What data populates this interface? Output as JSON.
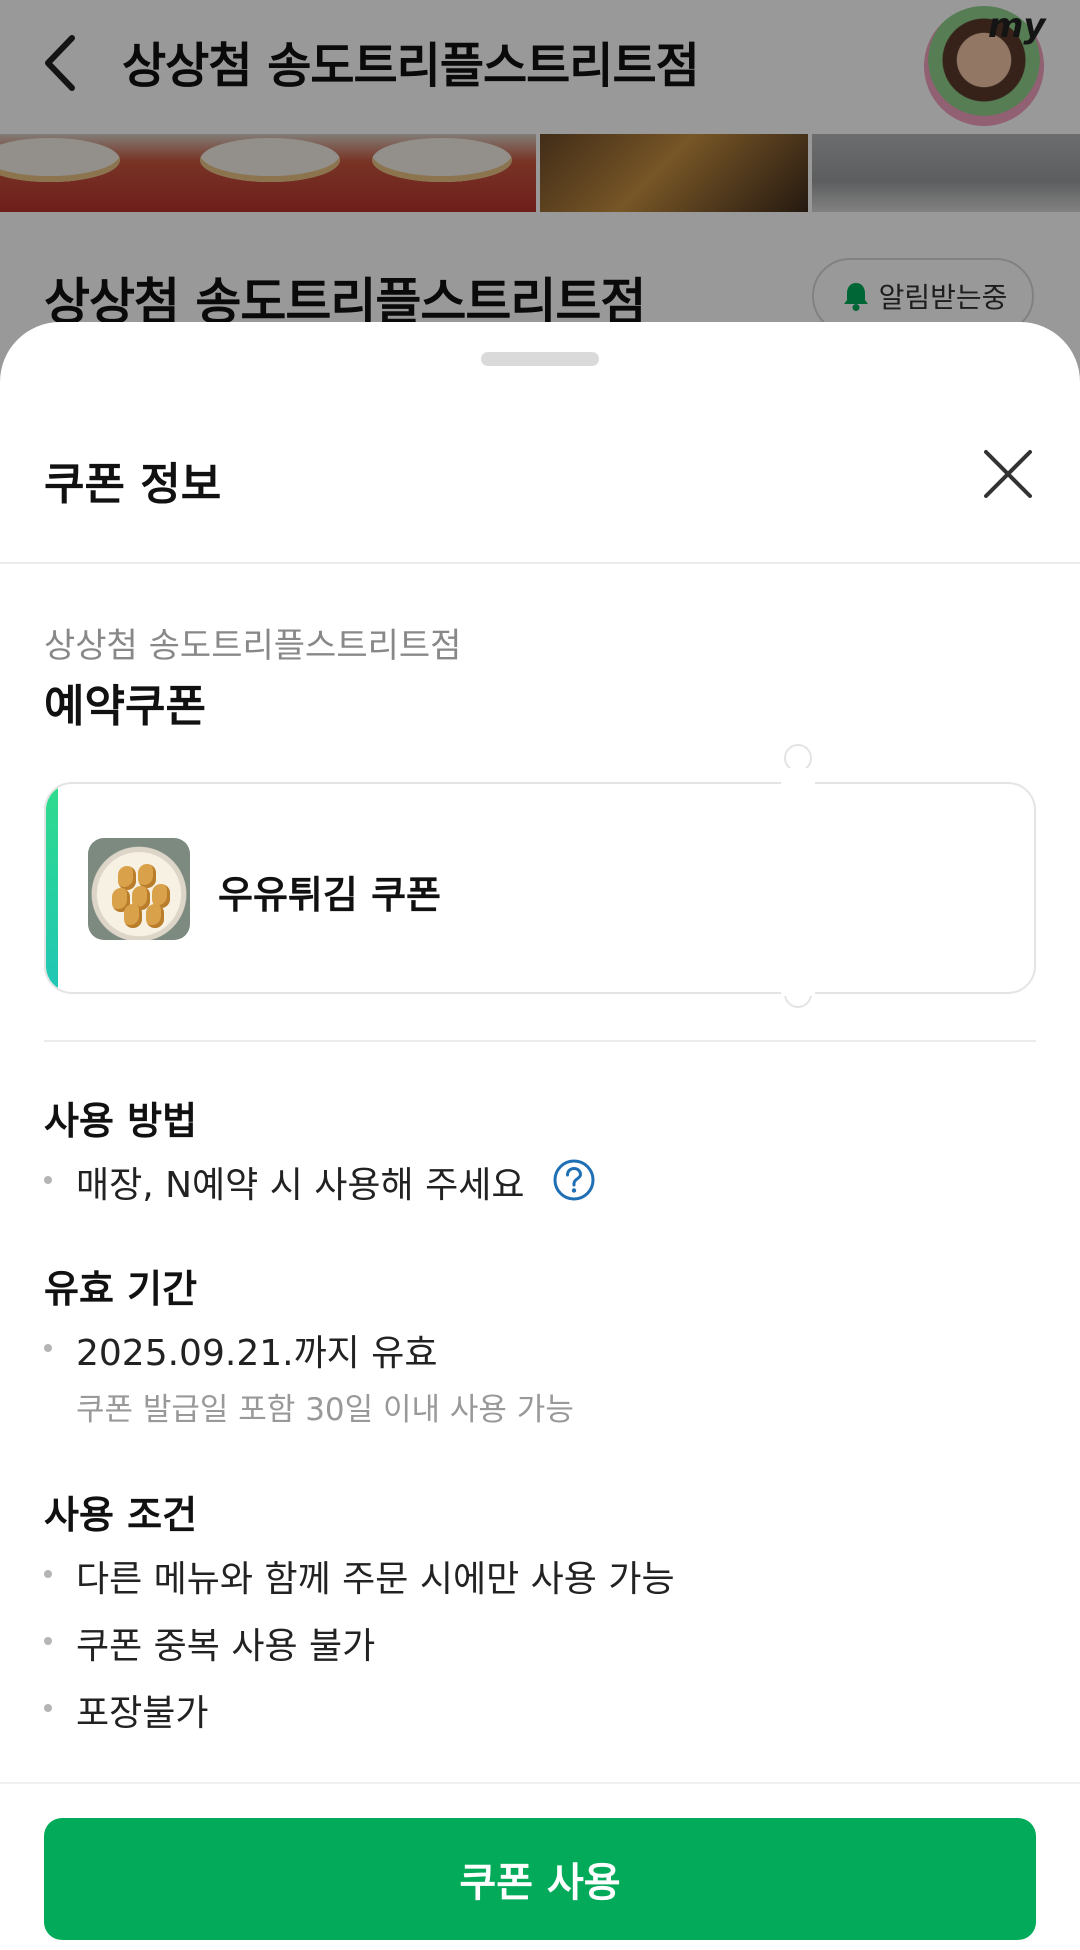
{
  "background": {
    "header_title": "상상첨 송도트리플스트리트점",
    "avatar_badge": "my",
    "store_name": "상상첨 송도트리플스트리트점",
    "notify_label": "알림받는중"
  },
  "sheet": {
    "title": "쿠폰 정보",
    "store": "상상첨 송도트리플스트리트점",
    "coupon_type": "예약쿠폰",
    "coupon_name": "우유튀김 쿠폰",
    "usage": {
      "title": "사용 방법",
      "item": "매장, N예약 시 사용해 주세요"
    },
    "validity": {
      "title": "유효 기간",
      "item": "2025.09.21.까지 유효",
      "note": "쿠폰 발급일 포함 30일 이내 사용 가능"
    },
    "conditions": {
      "title": "사용 조건",
      "items": [
        "다른 메뉴와 함께 주문 시에만 사용 가능",
        "쿠폰 중복 사용 불가",
        "포장불가"
      ]
    },
    "use_button": "쿠폰 사용"
  },
  "colors": {
    "primary_green": "#03aa5a",
    "accent_gradient_start": "#2fdc8c",
    "accent_gradient_end": "#20c6b6",
    "help_icon_blue": "#1f6fb5"
  },
  "icons": [
    "back-arrow-icon",
    "bell-icon",
    "close-icon",
    "help-question-icon"
  ]
}
